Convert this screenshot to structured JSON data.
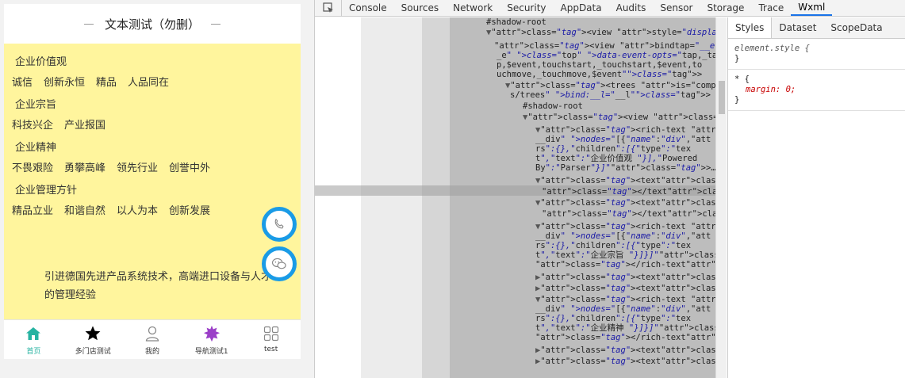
{
  "simulator": {
    "nav_title": "文本测试（勿删）",
    "sections": [
      {
        "title": "企业价值观",
        "items": [
          "诚信",
          "创新永恒",
          "精品",
          "人品同在"
        ]
      },
      {
        "title": "企业宗旨",
        "items": [
          "科技兴企",
          "产业报国"
        ]
      },
      {
        "title": "企业精神",
        "items": [
          "不畏艰险",
          "勇攀高峰",
          "领先行业",
          "创誉中外"
        ]
      },
      {
        "title": "企业管理方针",
        "items": [
          "精品立业",
          "和谐自然",
          "以人为本",
          "创新发展"
        ]
      }
    ],
    "description": "引进德国先进产品系统技术，高端进口设备与人才的管理经验",
    "fab_phone_icon": "phone-icon",
    "fab_chat_icon": "chat-icon",
    "tabs": [
      {
        "label": "首页",
        "icon": "home-icon",
        "active": true
      },
      {
        "label": "多门店测试",
        "icon": "star-icon",
        "active": false
      },
      {
        "label": "我的",
        "icon": "user-icon",
        "active": false
      },
      {
        "label": "导航测试1",
        "icon": "badge-icon",
        "active": false
      },
      {
        "label": "test",
        "icon": "grid-icon",
        "active": false
      }
    ],
    "colors": {
      "content_bg": "#fff59d",
      "fab_ring": "#1a9be6",
      "tab_active": "#27b3a2",
      "star": "#000000",
      "badge": "#9b3fc8"
    }
  },
  "devtools": {
    "tabs": [
      "Console",
      "Sources",
      "Network",
      "Security",
      "AppData",
      "Audits",
      "Sensor",
      "Storage",
      "Trace",
      "Wxml"
    ],
    "active_tab": "Wxml",
    "style_tabs": [
      "Styles",
      "Dataset",
      "ScopeData"
    ],
    "active_style_tab": "Styles",
    "style_rules": [
      {
        "selector": "element.style {",
        "declaration": "",
        "close": "}"
      },
      {
        "selector": "* {",
        "declaration": "margin: 0;",
        "close": "}"
      }
    ],
    "tree_lines": [
      "#shadow-root",
      "<view style=\"display:inherit;\">",
      "<view bindtap=\"__e\" bindtouchmove=\"__e\"",
      "_e\" class=\"top\" data-event-opts=\"tap,_ta",
      "p,$event,touchstart,_touchstart,$event,to",
      "uchmove,_touchmove,$event\">",
      "<trees is=\"components/jyf-parser/lib",
      "s/trees\" bind:__l=\"__l\">",
      "#shadow-root",
      "<view class=\"interlayer\">",
      "<rich-text class=\"_p",
      "__div\" nodes=\"[{\"name\":\"div\",\"att",
      "rs\":{},\"children\":[{\"type\":\"tex",
      "t\",\"text\":\"企业价值观 \"}],\"Powered",
      "By\":\"Parser\"}]\">…</rich-text>",
      "<text>",
      "</text>",
      "<text>",
      "</text>",
      "<rich-text class=\"_p",
      "__div\" nodes=\"[{\"name\":\"div\",\"att",
      "rs\":{},\"children\":[{\"type\":\"tex",
      "t\",\"text\":\"企业宗旨 \"}]}]\">…",
      "</rich-text>",
      "<text>…</text>",
      "<text>…</text>",
      "<rich-text class=\"_p",
      "__div\" nodes=\"[{\"name\":\"div\",\"att",
      "rs\":{},\"children\":[{\"type\":\"tex",
      "t\",\"text\":\"企业精神 \"}]}]\">…",
      "</rich-text>",
      "<text>…</text>",
      "<text>…</text>"
    ]
  }
}
